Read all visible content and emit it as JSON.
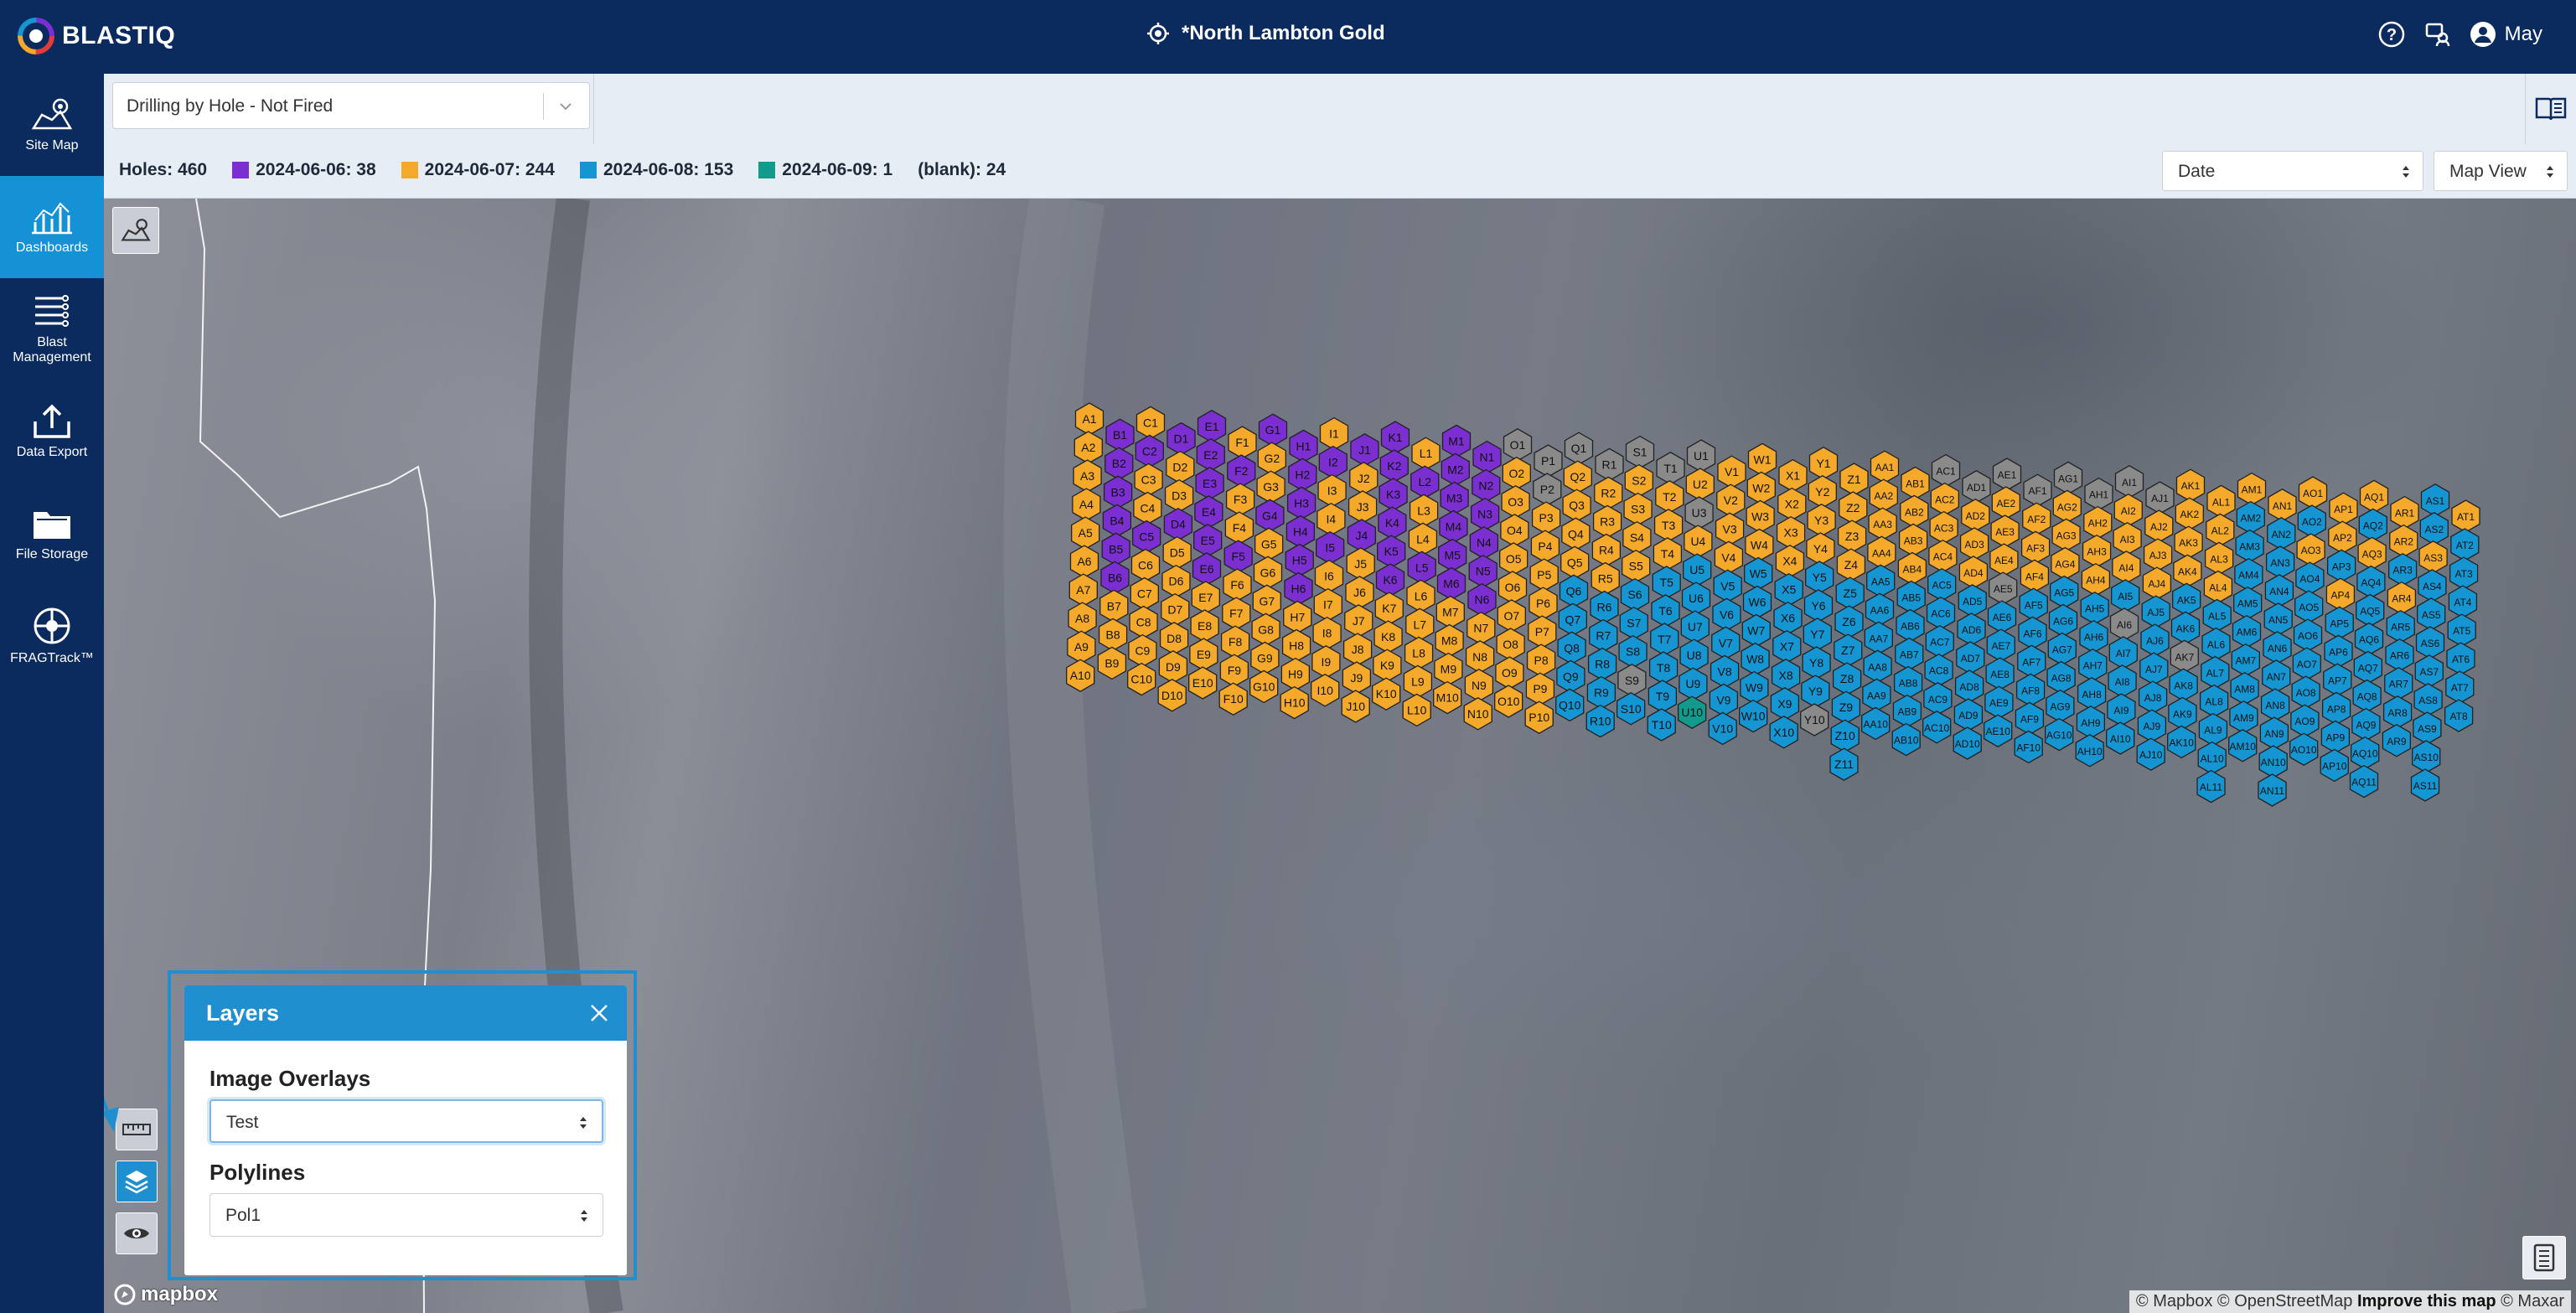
{
  "app": {
    "name": "BLASTIQ",
    "site": "*North Lambton Gold",
    "user": "May"
  },
  "nav": [
    {
      "label": "Site Map",
      "icon": "map-icon"
    },
    {
      "label": "Dashboards",
      "icon": "dashboard-icon",
      "active": true
    },
    {
      "label": "Blast Management",
      "icon": "list-icon"
    },
    {
      "label": "Data Export",
      "icon": "export-icon"
    },
    {
      "label": "File Storage",
      "icon": "folder-icon"
    },
    {
      "label": "FRAGTrack™",
      "icon": "fragtrack-icon"
    }
  ],
  "toolbar": {
    "dashboard_select": "Drilling by Hole - Not Fired"
  },
  "legend": {
    "holes": "Holes: 460",
    "items": [
      {
        "label": "2024-06-06: 38",
        "color": "#7b2fd0"
      },
      {
        "label": "2024-06-07: 244",
        "color": "#f4a92b"
      },
      {
        "label": "2024-06-08: 153",
        "color": "#1596d3"
      },
      {
        "label": "2024-06-09: 1",
        "color": "#129a8c"
      }
    ],
    "blank": "(blank): 24",
    "blank_color": "#8a8a8a"
  },
  "controls": {
    "color_by": "Date",
    "view": "Map View"
  },
  "layers": {
    "title": "Layers",
    "image_overlays_label": "Image Overlays",
    "image_overlays_value": "Test",
    "polylines_label": "Polylines",
    "polylines_value": "Pol1"
  },
  "attribution": {
    "text": "© Mapbox © OpenStreetMap",
    "improve": "Improve this map",
    "maxar": "© Maxar"
  },
  "mapbox_logo": "mapbox",
  "holes": [
    {
      "col": "A",
      "n": 10
    },
    {
      "col": "B",
      "n": 9
    },
    {
      "col": "C",
      "n": 10
    },
    {
      "col": "D",
      "n": 10
    },
    {
      "col": "E",
      "n": 10
    },
    {
      "col": "F",
      "n": 10
    },
    {
      "col": "G",
      "n": 10
    },
    {
      "col": "H",
      "n": 10
    },
    {
      "col": "I",
      "n": 10
    },
    {
      "col": "J",
      "n": 10
    },
    {
      "col": "K",
      "n": 10
    },
    {
      "col": "L",
      "n": 10
    },
    {
      "col": "M",
      "n": 10
    },
    {
      "col": "N",
      "n": 10
    },
    {
      "col": "O",
      "n": 10
    },
    {
      "col": "P",
      "n": 10
    },
    {
      "col": "Q",
      "n": 10
    },
    {
      "col": "R",
      "n": 10
    },
    {
      "col": "S",
      "n": 10
    },
    {
      "col": "T",
      "n": 10
    },
    {
      "col": "U",
      "n": 10
    },
    {
      "col": "V",
      "n": 10
    },
    {
      "col": "W",
      "n": 10
    },
    {
      "col": "X",
      "n": 10
    },
    {
      "col": "Y",
      "n": 10
    },
    {
      "col": "Z",
      "n": 11
    },
    {
      "col": "AA",
      "n": 10
    },
    {
      "col": "AB",
      "n": 10
    },
    {
      "col": "AC",
      "n": 10
    },
    {
      "col": "AD",
      "n": 10
    },
    {
      "col": "AE",
      "n": 10
    },
    {
      "col": "AF",
      "n": 10
    },
    {
      "col": "AG",
      "n": 10
    },
    {
      "col": "AH",
      "n": 10
    },
    {
      "col": "AI",
      "n": 10
    },
    {
      "col": "AJ",
      "n": 10
    },
    {
      "col": "AK",
      "n": 10
    },
    {
      "col": "AL",
      "n": 11
    },
    {
      "col": "AM",
      "n": 10
    },
    {
      "col": "AN",
      "n": 11
    },
    {
      "col": "AO",
      "n": 10
    },
    {
      "col": "AP",
      "n": 10
    },
    {
      "col": "AQ",
      "n": 11
    },
    {
      "col": "AR",
      "n": 9
    },
    {
      "col": "AS",
      "n": 11
    },
    {
      "col": "AT",
      "n": 8
    }
  ]
}
